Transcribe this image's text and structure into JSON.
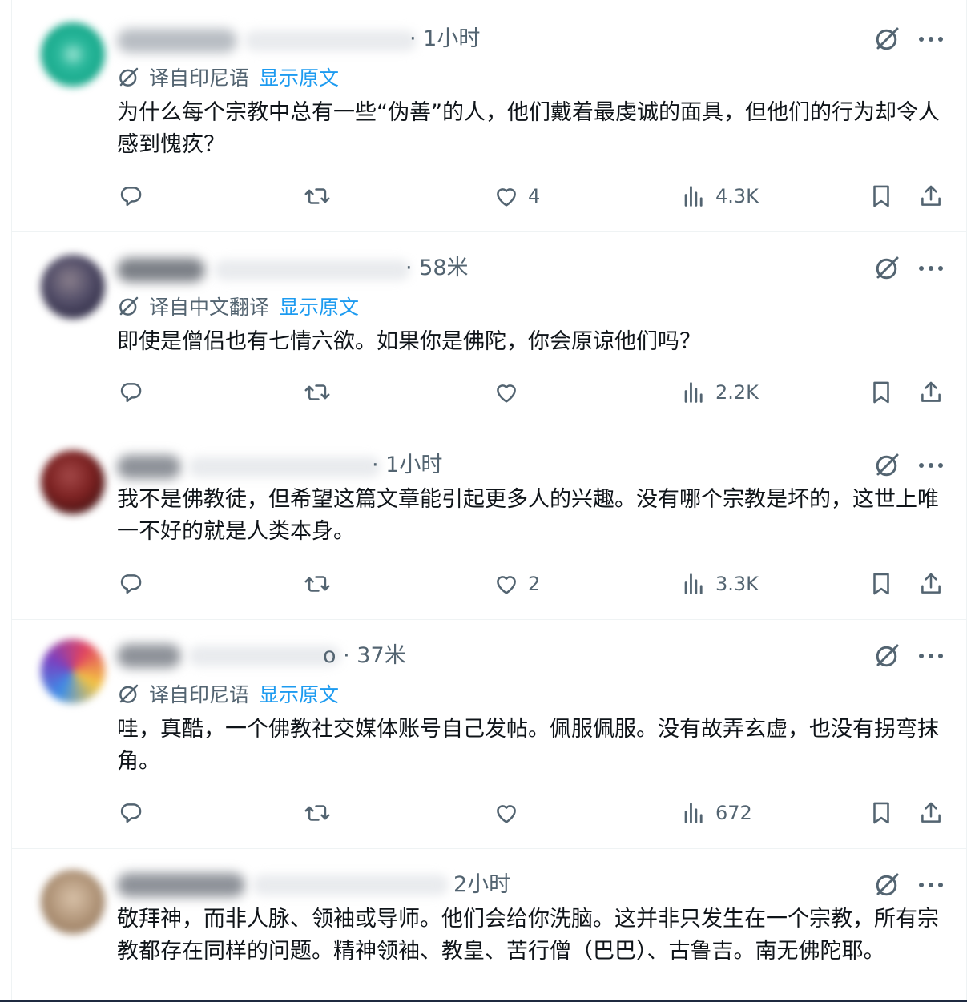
{
  "icons": {
    "reply": "reply-icon",
    "retweet": "retweet-icon",
    "like": "heart-icon",
    "views": "views-icon",
    "bookmark": "bookmark-icon",
    "share": "share-icon",
    "grok": "grok-icon",
    "more": "more-icon",
    "translate": "translate-icon"
  },
  "colors": {
    "link": "#1d9bf0",
    "muted": "#536471",
    "text": "#0f1419",
    "divider": "#eff3f4"
  },
  "tweets": [
    {
      "time": "· 1小时",
      "translation": {
        "label": "译自印尼语",
        "show_original": "显示原文"
      },
      "text": "为什么每个宗教中总有一些“伪善”的人，他们戴着最虔诚的面具，但他们的行为却令人感到愧疚？",
      "likes": "4",
      "views": "4.3K"
    },
    {
      "time": "· 58米",
      "translation": {
        "label": "译自中文翻译",
        "show_original": "显示原文"
      },
      "text": "即使是僧侣也有七情六欲。如果你是佛陀，你会原谅他们吗？",
      "likes": "",
      "views": "2.2K"
    },
    {
      "time": "· 1小时",
      "text": "我不是佛教徒，但希望这篇文章能引起更多人的兴趣。没有哪个宗教是坏的，这世上唯一不好的就是人类本身。",
      "likes": "2",
      "views": "3.3K"
    },
    {
      "time": "o · 37米",
      "translation": {
        "label": "译自印尼语",
        "show_original": "显示原文"
      },
      "text": "哇，真酷，一个佛教社交媒体账号自己发帖。佩服佩服。没有故弄玄虚，也没有拐弯抹角。",
      "likes": "",
      "views": "672"
    },
    {
      "time": "2小时",
      "text": "敬拜神，而非人脉、领袖或导师。他们会给你洗脑。这并非只发生在一个宗教，所有宗教都存在同样的问题。精神领袖、教皇、苦行僧（巴巴）、古鲁吉。南无佛陀耶。"
    }
  ]
}
